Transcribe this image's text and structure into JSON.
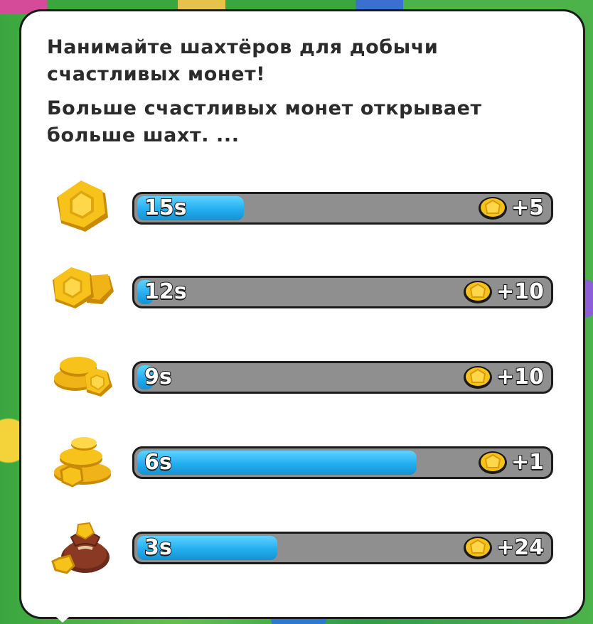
{
  "popup": {
    "line1": "Нанимайте шахтёров для добычи счастливых монет!",
    "line2": "Больше счастливых монет открывает больше шахт. ..."
  },
  "colors": {
    "bar_fill": "#23aef0",
    "bar_track": "#8f8f8f",
    "coin_gold": "#f7c21a",
    "panel": "#ffffff"
  },
  "miners": [
    {
      "icon": "single-coin-icon",
      "time": "15s",
      "progress": 0.26,
      "reward": "+5"
    },
    {
      "icon": "coin-nugget-icon",
      "time": "12s",
      "progress": 0.04,
      "reward": "+10"
    },
    {
      "icon": "coin-stack-icon",
      "time": "9s",
      "progress": 0.04,
      "reward": "+10"
    },
    {
      "icon": "coin-pile-icon",
      "time": "6s",
      "progress": 0.68,
      "reward": "+1"
    },
    {
      "icon": "coin-sack-icon",
      "time": "3s",
      "progress": 0.34,
      "reward": "+24"
    }
  ]
}
